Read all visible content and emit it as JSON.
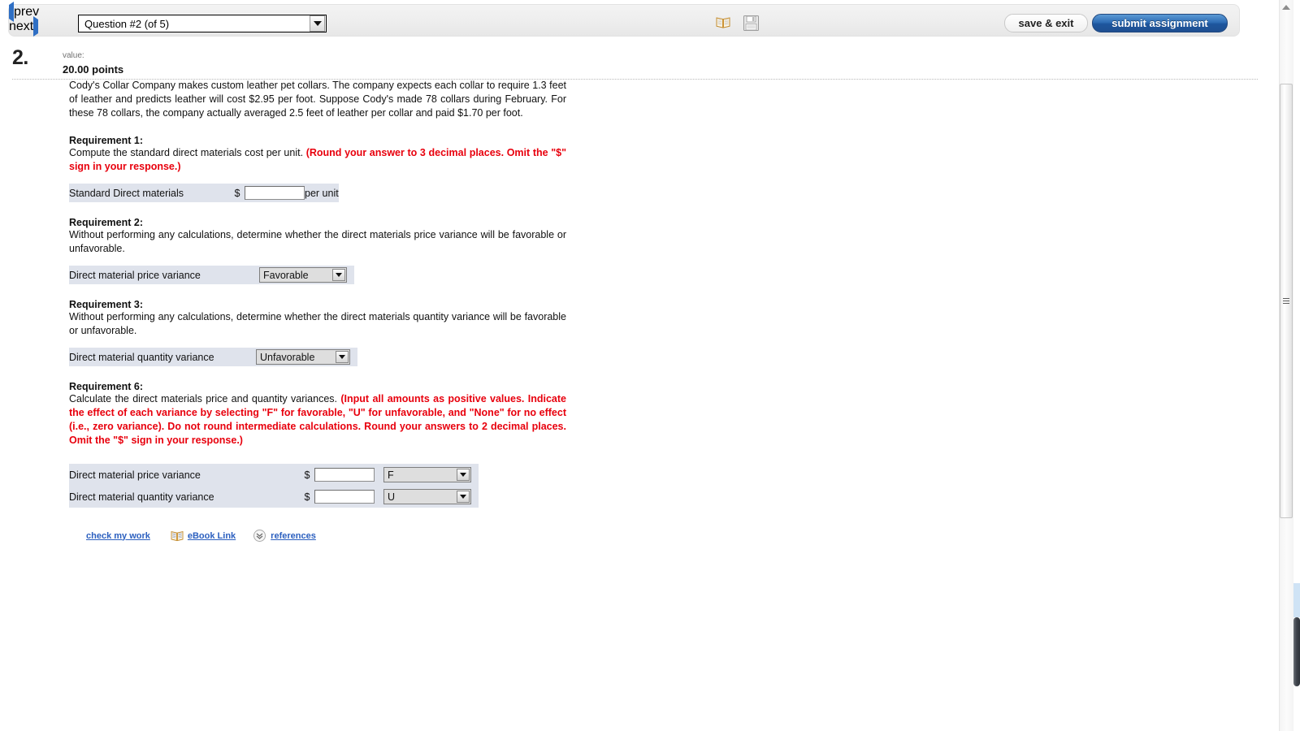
{
  "toolbar": {
    "prev_label": "prev",
    "next_label": "next",
    "question_selected": "Question #2 (of 5)",
    "save_exit_label": "save & exit",
    "submit_label": "submit assignment",
    "ebook_icon": "book-icon",
    "save_icon": "floppy-disk-icon"
  },
  "question": {
    "number": "2.",
    "value_label": "value:",
    "points": "20.00 points",
    "prompt": "Cody's Collar Company makes custom leather pet collars. The company expects each collar to require 1.3 feet of leather and predicts leather will cost $2.95 per foot. Suppose Cody's made 78 collars during February. For these 78 collars, the company actually averaged 2.5 feet of leather per collar and paid $1.70 per foot."
  },
  "requirements": [
    {
      "title": "Requirement 1:",
      "text_black": "Compute the standard direct materials cost per unit. ",
      "text_red": "(Round your answer to 3 decimal places. Omit the \"$\" sign in your response.)",
      "row_label": "Standard Direct materials",
      "currency": "$",
      "input_value": "",
      "unit": "per unit"
    },
    {
      "title": "Requirement 2:",
      "text_black": "Without performing any calculations, determine whether the direct materials price variance will be favorable or unfavorable.",
      "text_red": "",
      "row_label": "Direct material price variance",
      "select_value": "Favorable"
    },
    {
      "title": "Requirement 3:",
      "text_black": "Without performing any calculations, determine whether the direct materials quantity variance will be favorable or unfavorable.",
      "text_red": "",
      "row_label": "Direct material quantity variance",
      "select_value": "Unfavorable"
    },
    {
      "title": "Requirement 6:",
      "text_black": "Calculate the direct materials price and quantity variances. ",
      "text_red": "(Input all amounts as positive values. Indicate the effect of each variance by selecting \"F\" for favorable, \"U\" for unfavorable, and \"None\" for no effect (i.e., zero variance). Do not round intermediate calculations. Round your answers to 2 decimal places. Omit the \"$\" sign in your response.)",
      "rows": [
        {
          "label": "Direct material price variance",
          "currency": "$",
          "input_value": "",
          "select_value": "F"
        },
        {
          "label": "Direct material quantity variance",
          "currency": "$",
          "input_value": "",
          "select_value": "U"
        }
      ]
    }
  ],
  "footer": {
    "check_my_work": "check my work",
    "ebook_link": "eBook Link",
    "references": "references",
    "ebook_icon": "book-icon",
    "chevrons_icon": "double-chevron-down-icon"
  },
  "colors": {
    "red_instruction": "#e8000d",
    "link_blue": "#2b5fbf",
    "submit_blue": "#2f6db5",
    "row_bg": "#dfe3ec"
  }
}
